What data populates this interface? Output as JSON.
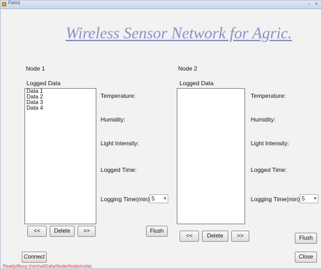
{
  "window": {
    "title": "Form1",
    "controls": [
      "–",
      "x"
    ]
  },
  "banner": {
    "title": "Wireless Sensor Network for Agric."
  },
  "node1": {
    "title": "Node 1",
    "logged_label": "Logged Data",
    "list_items": [
      "Data 1",
      "Data 2",
      "Data 3",
      "Data 4"
    ],
    "temperature_label": "Temperature:",
    "humidity_label": "Humidity:",
    "light_label": "Light Intensity:",
    "logged_time_label": "Logged Time:",
    "logging_time_label": "Logging Time(min)",
    "logging_time_value": "5",
    "prev_label": "<<",
    "delete_label": "Delete",
    "next_label": ">>",
    "flush_label": "Flush"
  },
  "node2": {
    "title": "Node 2",
    "logged_label": "Logged Data",
    "list_items": [],
    "temperature_label": "Temperature:",
    "humidity_label": "Humidity:",
    "light_label": "Light Intensity:",
    "logged_time_label": "Logged Time:",
    "logging_time_label": "Logging Time(min)",
    "logging_time_value": "5",
    "prev_label": "<<",
    "delete_label": "Delete",
    "next_label": ">>",
    "flush_label": "Flush"
  },
  "footer": {
    "connect_label": "Connect",
    "close_label": "Close",
    "status_text": "Ready/Busy (normal/Data/Node/Node/node)"
  },
  "icons": {
    "app": "form-app-icon",
    "dropdown": "dropdown-arrow-icon"
  }
}
